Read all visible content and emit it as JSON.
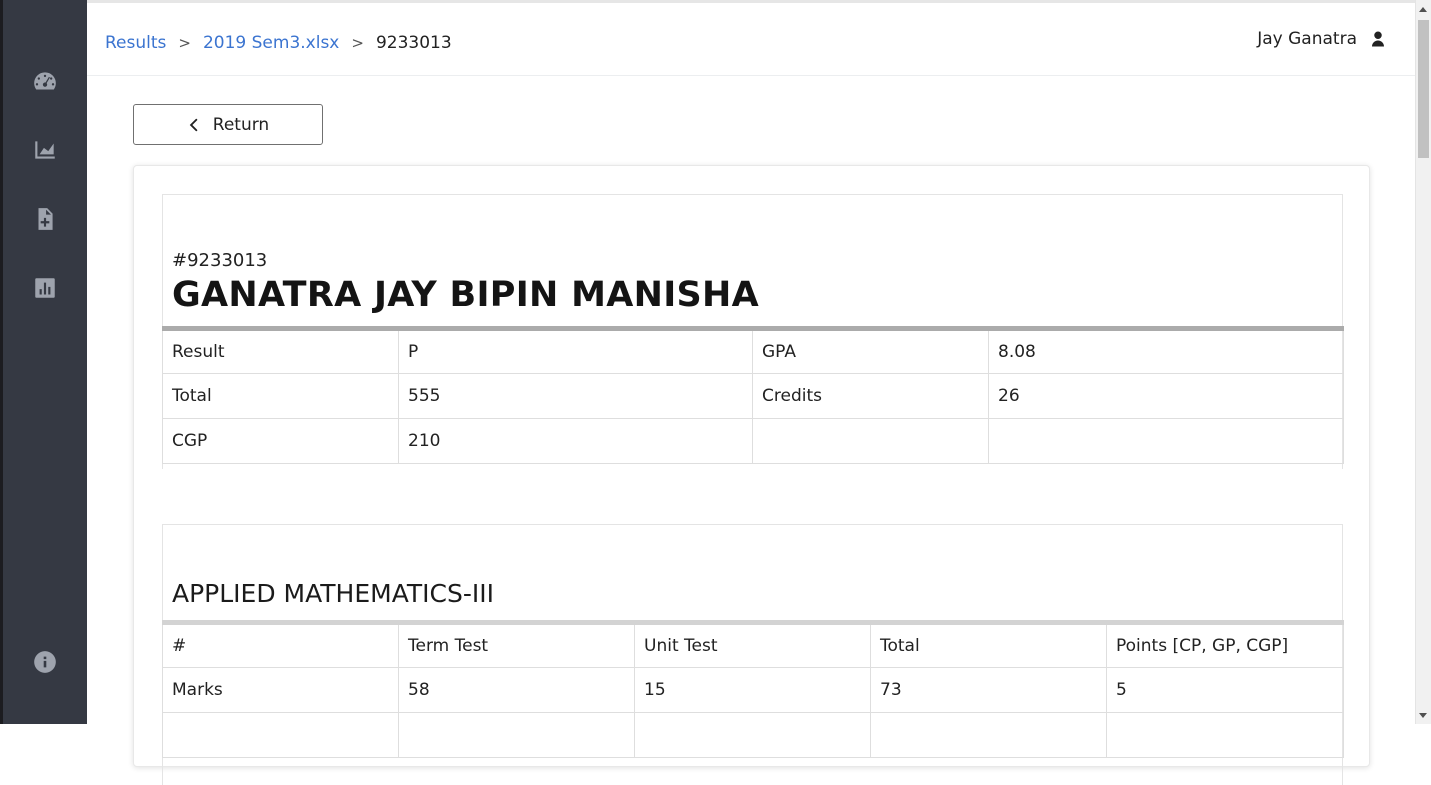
{
  "breadcrumb": {
    "root": "Results",
    "file": "2019 Sem3.xlsx",
    "current": "9233013",
    "separator": ">"
  },
  "user": {
    "name": "Jay Ganatra",
    "icon": "user-icon"
  },
  "sidebar": {
    "items": [
      {
        "icon": "dashboard-icon"
      },
      {
        "icon": "area-chart-icon"
      },
      {
        "icon": "file-add-icon"
      },
      {
        "icon": "bar-chart-icon"
      }
    ],
    "footer_icon": "info-icon"
  },
  "return_label": "Return",
  "student": {
    "id": "#9233013",
    "name": "GANATRA JAY BIPIN MANISHA",
    "summary": [
      [
        "Result",
        "P",
        "GPA",
        "8.08"
      ],
      [
        "Total",
        "555",
        "Credits",
        "26"
      ],
      [
        "CGP",
        "210",
        "",
        ""
      ]
    ]
  },
  "subject": {
    "title": "APPLIED MATHEMATICS-III",
    "headers": [
      "#",
      "Term Test",
      "Unit Test",
      "Total",
      "Points   [CP, GP, CGP]"
    ],
    "rows": [
      [
        "Marks",
        "58",
        "15",
        "73",
        "5"
      ]
    ]
  },
  "colors": {
    "sidebar_bg": "#353943",
    "link": "#3b74d0",
    "icon": "#9ea3ad"
  }
}
